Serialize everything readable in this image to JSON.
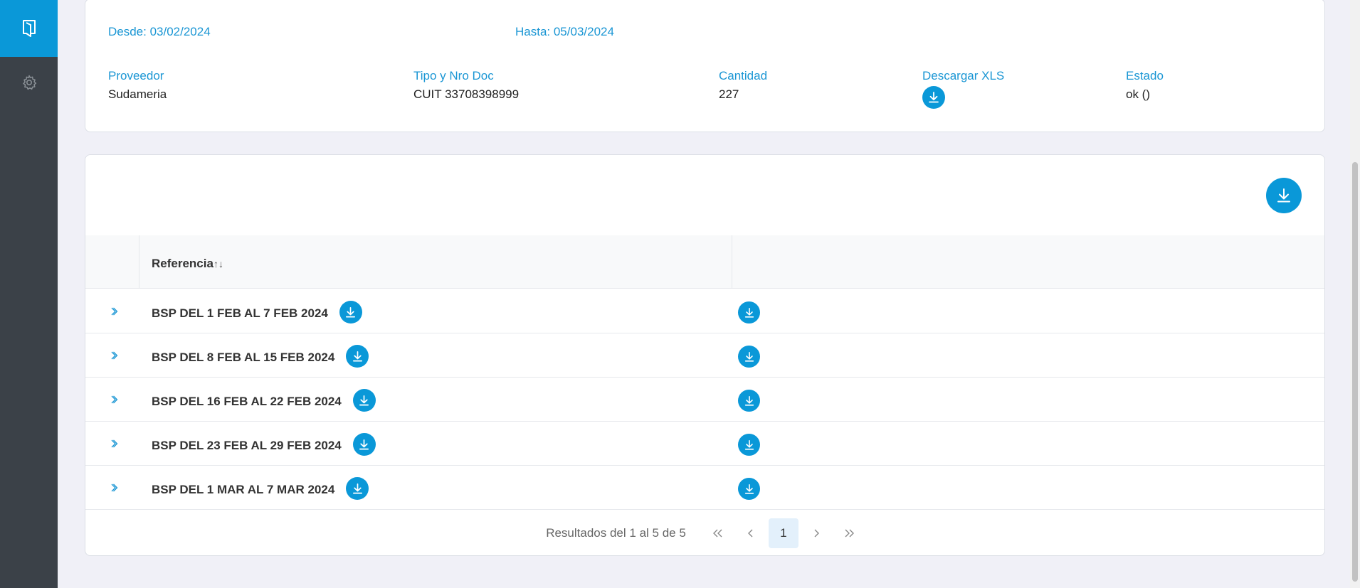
{
  "colors": {
    "accent": "#0a98d8",
    "sidebar": "#3b4148",
    "label": "#1a96d4"
  },
  "sidebar": {
    "top_icon": "book-open-icon",
    "gear_icon": "gear-icon"
  },
  "summary": {
    "desde": "Desde: 03/02/2024",
    "hasta": "Hasta: 05/03/2024",
    "proveedor_label": "Proveedor",
    "proveedor_value": "Sudameria",
    "tipo_label": "Tipo y Nro Doc",
    "tipo_value": "CUIT 33708398999",
    "cantidad_label": "Cantidad",
    "cantidad_value": "227",
    "xls_label": "Descargar XLS",
    "estado_label": "Estado",
    "estado_value": "ok ()"
  },
  "table": {
    "header_ref": "Referencia",
    "sort_glyph": "↑↓",
    "rows": [
      {
        "ref": "BSP DEL 1 FEB AL 7 FEB 2024"
      },
      {
        "ref": "BSP DEL 8 FEB AL 15 FEB 2024"
      },
      {
        "ref": "BSP DEL 16 FEB AL 22 FEB 2024"
      },
      {
        "ref": "BSP DEL 23 FEB AL 29 FEB 2024"
      },
      {
        "ref": "BSP DEL 1 MAR AL 7 MAR 2024"
      }
    ]
  },
  "pager": {
    "summary": "Resultados del 1 al 5 de 5",
    "first": "«",
    "prev": "‹",
    "current": "1",
    "next": "›",
    "last": "»"
  }
}
